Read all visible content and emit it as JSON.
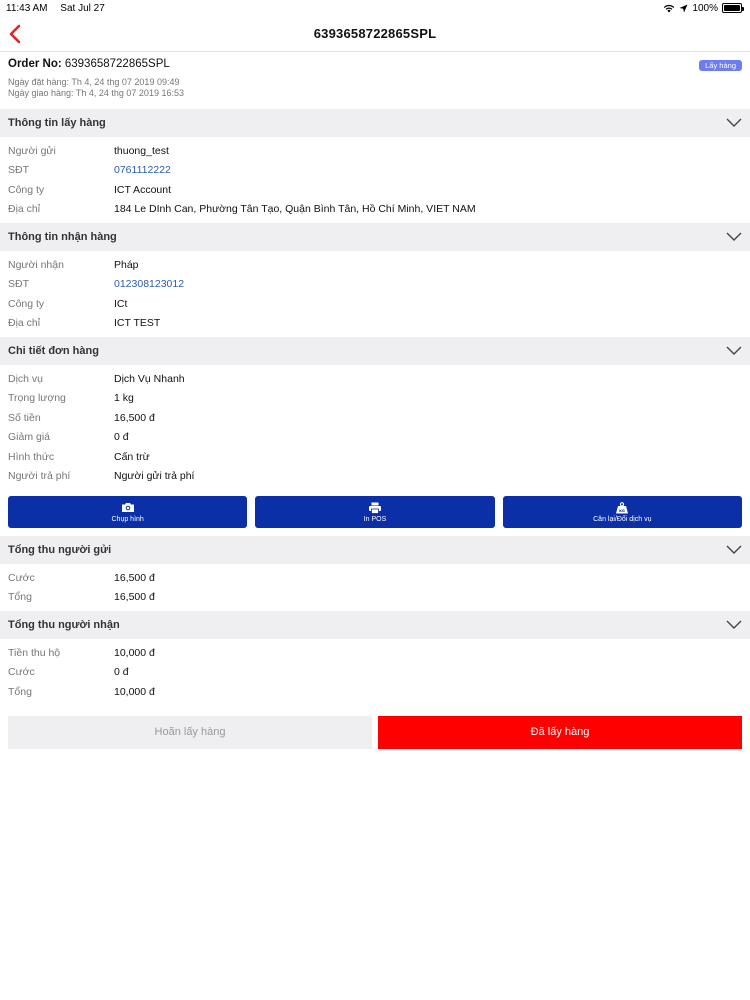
{
  "status_bar": {
    "time": "11:43 AM",
    "date": "Sat Jul 27",
    "battery": "100%",
    "battery_level": 1.0
  },
  "nav": {
    "title": "6393658722865SPL"
  },
  "order": {
    "label": "Order No:",
    "number": "6393658722865SPL",
    "badge": "Lấy hàng",
    "order_date": "Ngày đặt hàng: Th 4, 24 thg 07 2019 09:49",
    "delivery_date": "Ngày giao hàng: Th 4, 24 thg 07 2019 16:53"
  },
  "pickup": {
    "title": "Thông tin lấy hàng",
    "rows": [
      {
        "label": "Người gửi",
        "value": "thuong_test"
      },
      {
        "label": "SĐT",
        "value": "0761112222"
      },
      {
        "label": "Công ty",
        "value": "ICT Account"
      },
      {
        "label": "Địa chỉ",
        "value": "184 Le DInh Can, Phường Tân Tạo, Quận Bình Tân, Hồ Chí Minh, VIET NAM"
      }
    ]
  },
  "receiver": {
    "title": "Thông tin nhận hàng",
    "rows": [
      {
        "label": "Người nhận",
        "value": "Pháp"
      },
      {
        "label": "SĐT",
        "value": "012308123012"
      },
      {
        "label": "Công ty",
        "value": "ICt"
      },
      {
        "label": "Địa chỉ",
        "value": "ICT TEST"
      }
    ]
  },
  "details": {
    "title": "Chi tiết đơn hàng",
    "rows": [
      {
        "label": "Dịch vụ",
        "value": "Dịch Vụ Nhanh"
      },
      {
        "label": "Trọng lượng",
        "value": "1 kg"
      },
      {
        "label": "Số tiền",
        "value": "16,500 đ"
      },
      {
        "label": "Giảm giá",
        "value": "0 đ"
      },
      {
        "label": "Hình thức",
        "value": "Cấn trừ"
      },
      {
        "label": "Người trả phí",
        "value": "Người gửi trả phí"
      }
    ]
  },
  "actions": {
    "photo": "Chụp hình",
    "print": "In POS",
    "reweigh": "Cân lại/Đổi dịch vụ"
  },
  "sender_total": {
    "title": "Tổng thu người gửi",
    "rows": [
      {
        "label": "Cước",
        "value": "16,500 đ"
      },
      {
        "label": "Tổng",
        "value": "16,500 đ"
      }
    ]
  },
  "receiver_total": {
    "title": "Tổng thu người nhận",
    "rows": [
      {
        "label": "Tiền thu hộ",
        "value": "10,000 đ"
      },
      {
        "label": "Cước",
        "value": "0 đ"
      },
      {
        "label": "Tổng",
        "value": "10,000 đ"
      }
    ]
  },
  "bottom": {
    "postpone": "Hoãn lấy hàng",
    "picked": "Đã lấy hàng"
  },
  "colors": {
    "accent": "#e0242a",
    "action_blue": "#0a2fa6",
    "primary_red": "#ff0000",
    "link_blue": "#2a5db0",
    "badge": "#6d7cf0"
  }
}
